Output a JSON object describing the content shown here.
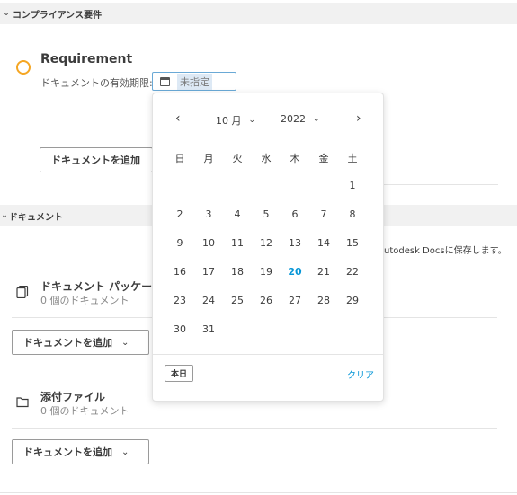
{
  "compliance_section": {
    "title": "コンプライアンス要件"
  },
  "requirement": {
    "title": "Requirement",
    "expiry_label": "ドキュメントの有効期限:",
    "date_placeholder": "未指定",
    "add_button": "ドキュメントを追加"
  },
  "documents_section": {
    "title": "ドキュメント",
    "hint_text": "utodesk Docsに保存します。"
  },
  "package": {
    "title": "ドキュメント パッケージ",
    "count": "0 個のドキュメント",
    "add_button": "ドキュメントを追加"
  },
  "attachments": {
    "title": "添付ファイル",
    "count": "0 個のドキュメント",
    "add_button": "ドキュメントを追加"
  },
  "datepicker": {
    "prev": "‹",
    "next": "›",
    "month": "10 月",
    "year": "2022",
    "weekdays": [
      "日",
      "月",
      "火",
      "水",
      "木",
      "金",
      "土"
    ],
    "weeks": [
      [
        "",
        "",
        "",
        "",
        "",
        "",
        "1"
      ],
      [
        "2",
        "3",
        "4",
        "5",
        "6",
        "7",
        "8"
      ],
      [
        "9",
        "10",
        "11",
        "12",
        "13",
        "14",
        "15"
      ],
      [
        "16",
        "17",
        "18",
        "19",
        "20",
        "21",
        "22"
      ],
      [
        "23",
        "24",
        "25",
        "26",
        "27",
        "28",
        "29"
      ],
      [
        "30",
        "31",
        "",
        "",
        "",
        "",
        ""
      ]
    ],
    "today_day": "20",
    "today_button": "本日",
    "clear_link": "クリア",
    "today_color": "#0696d7"
  }
}
